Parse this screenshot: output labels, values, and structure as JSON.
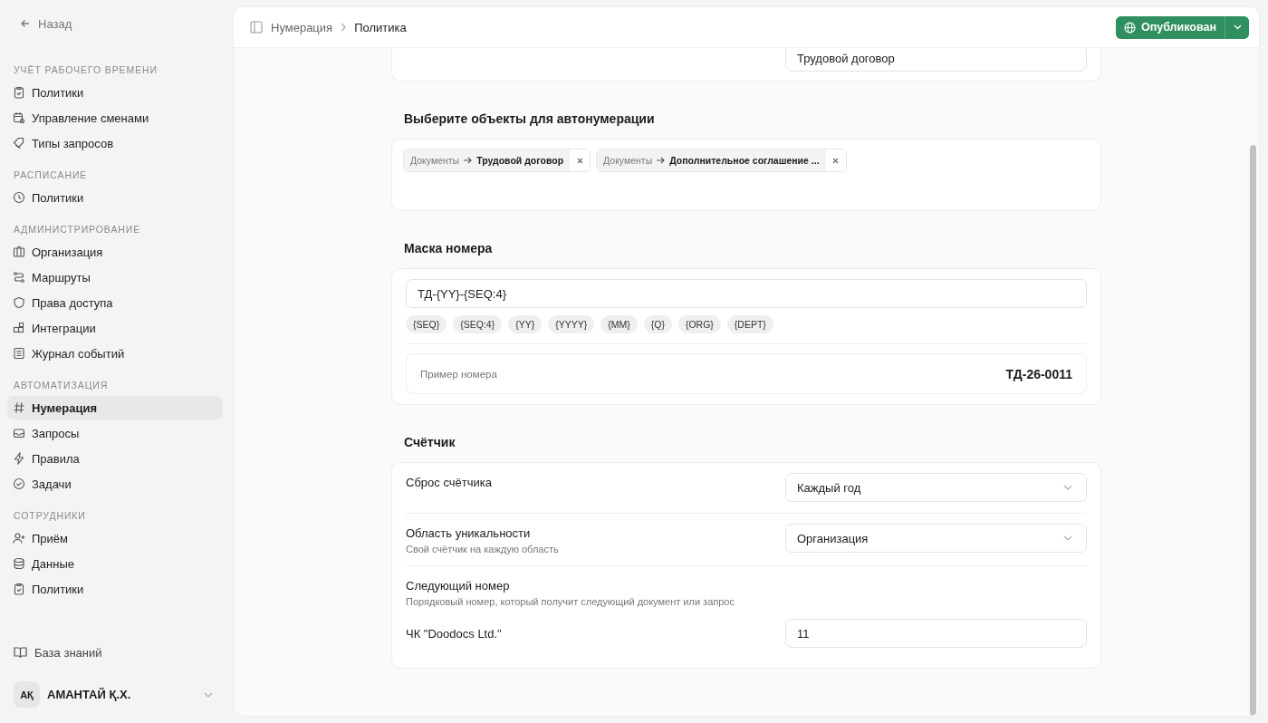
{
  "back": "Назад",
  "sidebar": {
    "sections": [
      {
        "title": "УЧЁТ РАБОЧЕГО ВРЕМЕНИ",
        "items": [
          {
            "label": "Политики",
            "selected": false
          },
          {
            "label": "Управление сменами",
            "selected": false
          },
          {
            "label": "Типы запросов",
            "selected": false
          }
        ]
      },
      {
        "title": "РАСПИСАНИЕ",
        "items": [
          {
            "label": "Политики",
            "selected": false
          }
        ]
      },
      {
        "title": "АДМИНИСТРИРОВАНИЕ",
        "items": [
          {
            "label": "Организация",
            "selected": false
          },
          {
            "label": "Маршруты",
            "selected": false
          },
          {
            "label": "Права доступа",
            "selected": false
          },
          {
            "label": "Интеграции",
            "selected": false
          },
          {
            "label": "Журнал событий",
            "selected": false
          }
        ]
      },
      {
        "title": "АВТОМАТИЗАЦИЯ",
        "items": [
          {
            "label": "Нумерация",
            "selected": true
          },
          {
            "label": "Запросы",
            "selected": false
          },
          {
            "label": "Правила",
            "selected": false
          },
          {
            "label": "Задачи",
            "selected": false
          }
        ]
      },
      {
        "title": "СОТРУДНИКИ",
        "items": [
          {
            "label": "Приём",
            "selected": false
          },
          {
            "label": "Данные",
            "selected": false
          },
          {
            "label": "Политики",
            "selected": false
          }
        ]
      }
    ],
    "footer_link": "База знаний",
    "user": {
      "initials": "АҚ",
      "name": "АМАНТАЙ Қ.Х."
    }
  },
  "breadcrumb": [
    "Нумерация",
    "Политика"
  ],
  "status_button": {
    "label": "Опубликован"
  },
  "document_type_field": {
    "value": "Трудовой договор"
  },
  "objects": {
    "title": "Выберите объекты для автонумерации",
    "tags": [
      {
        "category": "Документы",
        "name": "Трудовой договор"
      },
      {
        "category": "Документы",
        "name": "Дополнительное соглашение ..."
      }
    ]
  },
  "mask": {
    "title": "Маска номера",
    "value": "ТД-{YY}-{SEQ:4}",
    "tokens": [
      "{SEQ}",
      "{SEQ:4}",
      "{YY}",
      "{YYYY}",
      "{MM}",
      "{Q}",
      "{ORG}",
      "{DEPT}"
    ],
    "example_label": "Пример номера",
    "example_value": "ТД-26-0011"
  },
  "counter": {
    "title": "Счётчик",
    "rows": [
      {
        "kind": "select",
        "label": "Сброс счётчика",
        "value": "Каждый год"
      },
      {
        "kind": "select",
        "label": "Область уникальности",
        "hint": "Свой счётчик на каждую область",
        "value": "Организация"
      },
      {
        "kind": "info",
        "label": "Следующий номер",
        "hint": "Порядковый номер, который получит следующий документ или запрос"
      },
      {
        "kind": "input",
        "label": "ЧК \"Doodocs Ltd.\"",
        "value": "11"
      }
    ]
  }
}
